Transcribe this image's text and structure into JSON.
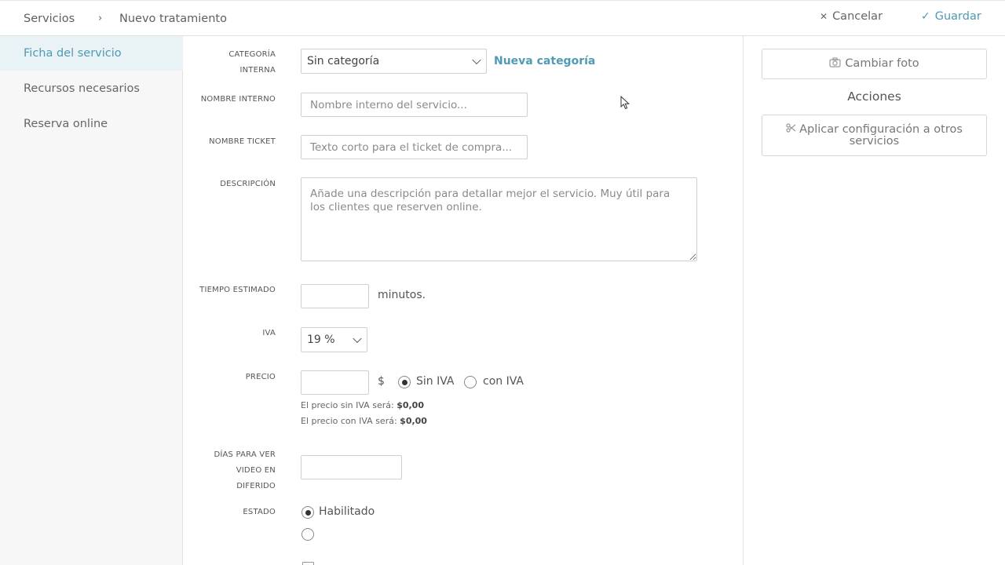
{
  "breadcrumb": {
    "parent": "Servicios",
    "separator": "›",
    "current": "Nuevo tratamiento"
  },
  "header": {
    "cancel_label": "Cancelar",
    "save_label": "Guardar",
    "accent": "#4f9ab5"
  },
  "sidebar": {
    "items": [
      {
        "label": "Ficha del servicio",
        "active": true
      },
      {
        "label": "Recursos necesarios",
        "active": false
      },
      {
        "label": "Reserva online",
        "active": false
      }
    ]
  },
  "form": {
    "category": {
      "label_line1": "CATEGORÍA",
      "label_line2": "INTERNA",
      "value": "Sin categoría",
      "new_link": "Nueva categoría"
    },
    "internal_name": {
      "label": "NOMBRE INTERNO",
      "placeholder": "Nombre interno del servicio...",
      "value": ""
    },
    "ticket_name": {
      "label": "NOMBRE TICKET",
      "placeholder": "Texto corto para el ticket de compra...",
      "value": ""
    },
    "description": {
      "label": "DESCRIPCIÓN",
      "placeholder": "Añade una descripción para detallar mejor el servicio. Muy útil para los clientes que reserven online.",
      "value": ""
    },
    "estimated_time": {
      "label": "TIEMPO ESTIMADO",
      "value": "",
      "unit": "minutos."
    },
    "iva": {
      "label": "IVA",
      "value": "19 %"
    },
    "price": {
      "label": "PRECIO",
      "value": "",
      "currency": "$",
      "option_without": "Sin IVA",
      "option_with": "con IVA",
      "selected": "Sin IVA",
      "hint_without_prefix": "El precio sin IVA será:",
      "hint_without_value": "$0,00",
      "hint_with_prefix": "El precio con IVA será:",
      "hint_with_value": "$0,00"
    },
    "deferred_days": {
      "label_line1": "DÍAS PARA VER",
      "label_line2": "VIDEO EN",
      "label_line3": "DIFERIDO",
      "value": ""
    },
    "status": {
      "label": "ESTADO",
      "option_enabled": "Habilitado",
      "selected": "Habilitado"
    }
  },
  "right_panel": {
    "change_photo_label": "Cambiar foto",
    "actions_title": "Acciones",
    "apply_config_line1": "Aplicar configuración a otros",
    "apply_config_line2": "servicios"
  }
}
